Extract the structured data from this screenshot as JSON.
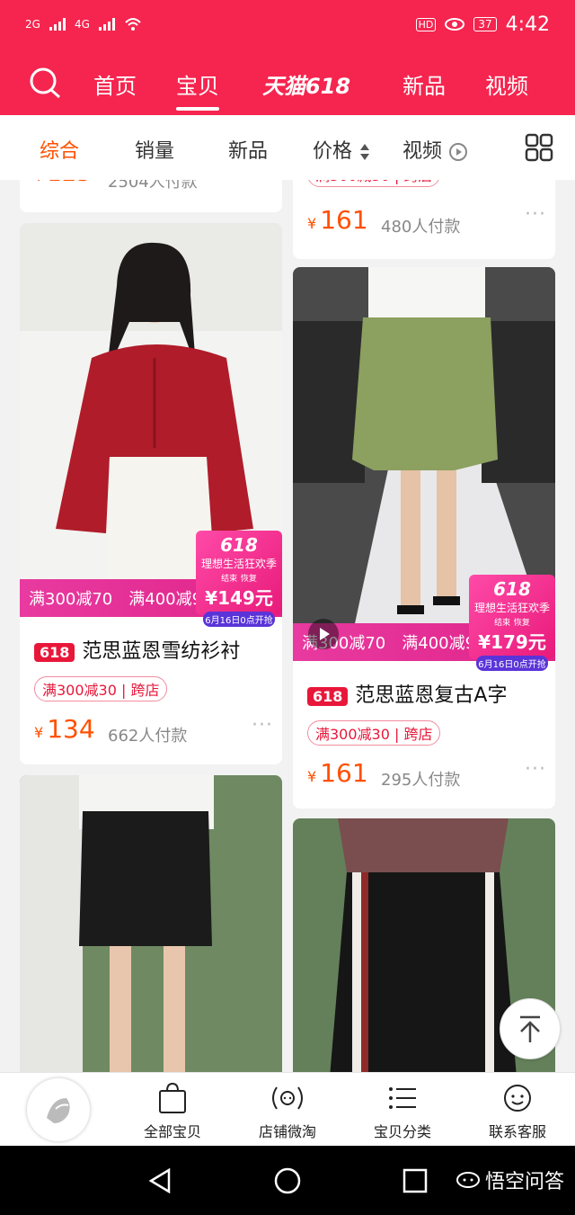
{
  "status_bar": {
    "net1": "2G",
    "net2": "4G",
    "battery": "37",
    "time": "4:42"
  },
  "nav": {
    "tabs": [
      "首页",
      "宝贝",
      "天猫618",
      "新品",
      "视频"
    ],
    "active": "宝贝"
  },
  "filters": {
    "items": [
      "综合",
      "销量",
      "新品",
      "价格",
      "视频"
    ],
    "active": "综合"
  },
  "products": [
    {
      "title": "",
      "promo": "满300减30 | 跨店",
      "price": "125",
      "sold": "2504人付款"
    },
    {
      "title": "",
      "promo": "满300减30 | 跨店",
      "price": "161",
      "sold": "480人付款"
    },
    {
      "title": "范思蓝恩雪纺衫衬",
      "tag": "618",
      "promo": "满300减30 | 跨店",
      "price": "134",
      "sold": "662人付款",
      "overlay": {
        "left": "满300减70",
        "right": "满400减90",
        "badge_title": "618",
        "badge_sub": "理想生活狂欢季",
        "badge_label1": "结束",
        "badge_label2": "恢复",
        "badge_price": "¥149元",
        "badge_date": "6月16日0点开抢"
      }
    },
    {
      "title": "范思蓝恩复古A字",
      "tag": "618",
      "promo": "满300减30 | 跨店",
      "price": "161",
      "sold": "295人付款",
      "overlay": {
        "left": "满300减70",
        "right": "满400减90",
        "badge_title": "618",
        "badge_sub": "理想生活狂欢季",
        "badge_label1": "结束",
        "badge_label2": "恢复",
        "badge_price": "¥179元",
        "badge_date": "6月16日0点开抢"
      }
    }
  ],
  "more_dots": "···",
  "yen": "¥",
  "tabbar": {
    "items": [
      "全部宝贝",
      "店铺微淘",
      "宝贝分类",
      "联系客服"
    ]
  },
  "watermark": "悟空问答",
  "colors": {
    "brand": "#f5254f",
    "price": "#ff5000",
    "promo": "#e8173a"
  }
}
